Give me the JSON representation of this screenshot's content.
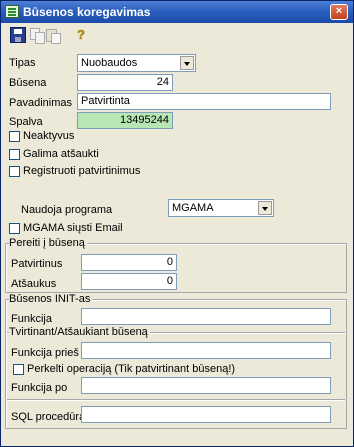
{
  "window": {
    "title": "Būsenos koregavimas",
    "close_label": "×"
  },
  "toolbar": {
    "icons": [
      "save-icon",
      "copy-icon",
      "paste-icon",
      "help-icon"
    ],
    "help_glyph": "?"
  },
  "form": {
    "tipas": {
      "label": "Tipas",
      "value": "Nuobaudos"
    },
    "busena": {
      "label": "Būsena",
      "value": "24"
    },
    "pavadinimas": {
      "label": "Pavadinimas",
      "value": "Patvirtinta"
    },
    "spalva": {
      "label": "Spalva",
      "value": "13495244",
      "color": "#b9e6b5"
    },
    "neaktyvus": {
      "label": "Neaktyvus",
      "checked": false
    },
    "galima_atsaukti": {
      "label": "Galima atšaukti",
      "checked": false
    },
    "registruoti": {
      "label": "Registruoti patvirtinimus",
      "checked": false
    },
    "naudoja_programa": {
      "label": "Naudoja programa",
      "value": "MGAMA"
    },
    "mgama_email": {
      "label": "MGAMA siųsti Email",
      "checked": false
    }
  },
  "pereiti": {
    "title": "Pereiti į būseną",
    "patvirtinus": {
      "label": "Patvirtinus",
      "value": "0"
    },
    "atsaukus": {
      "label": "Atšaukus",
      "value": "0"
    }
  },
  "init": {
    "title": "Būsenos INIT-as",
    "funkcija": {
      "label": "Funkcija",
      "value": ""
    }
  },
  "tvirtinant": {
    "title": "Tvirtinant/Atšaukiant būseną",
    "funkcija_pries": {
      "label": "Funkcija prieš",
      "value": ""
    },
    "perkelti": {
      "label": "Perkelti operaciją (Tik patvirtinant būseną!)",
      "checked": false
    },
    "funkcija_po": {
      "label": "Funkcija po",
      "value": ""
    }
  },
  "sql": {
    "label": "SQL procedūra",
    "value": ""
  }
}
